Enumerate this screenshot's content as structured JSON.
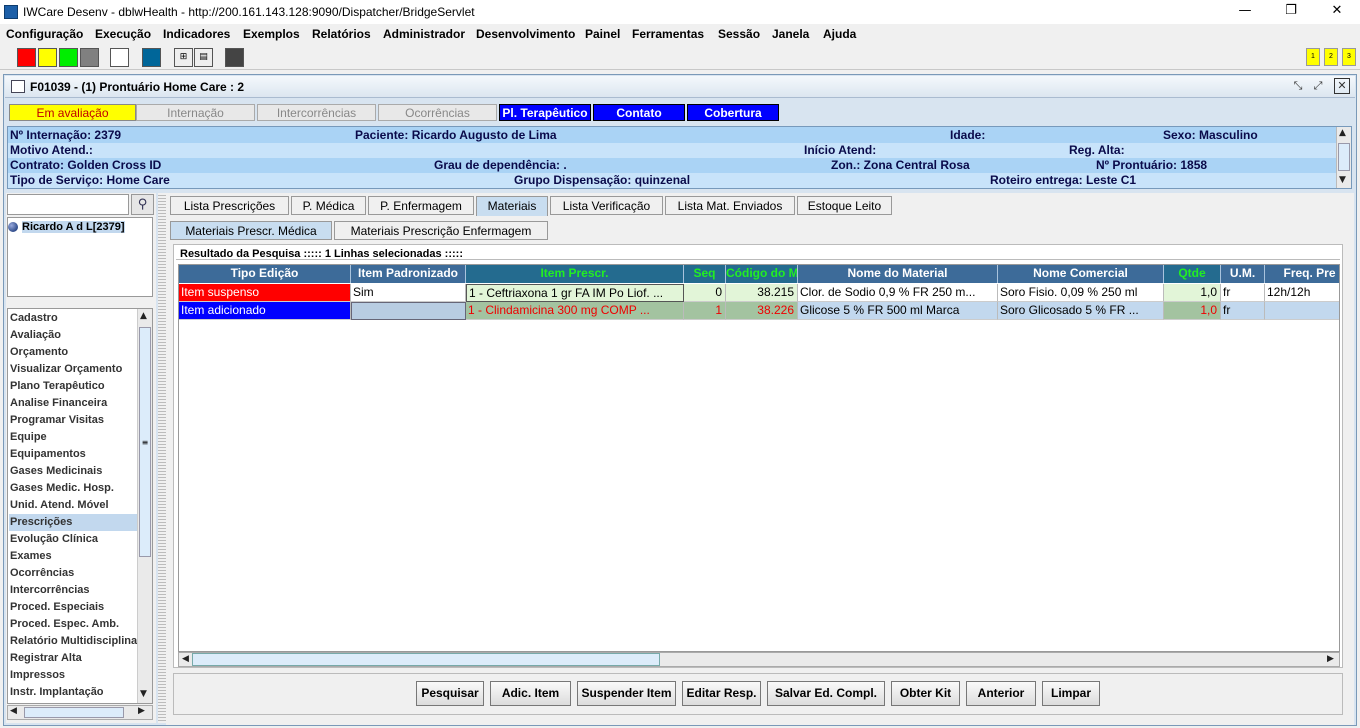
{
  "window": {
    "title": "IWCare Desenv - dblwHealth - http://200.161.143.128:9090/Dispatcher/BridgeServlet",
    "minimize": "—",
    "maximize": "❐",
    "close": "✕"
  },
  "menu": [
    "Configuração",
    "Execução",
    "Indicadores",
    "Exemplos",
    "Relatórios",
    "Administrador",
    "Desenvolvimento",
    "Painel",
    "Ferramentas",
    "Sessão",
    "Janela",
    "Ajuda"
  ],
  "toolbar": {
    "swatch_colors": [
      "#ff0000",
      "#ffff00",
      "#00ee00",
      "#808080",
      "#ffffff",
      "#006699",
      "#444444"
    ],
    "numbered_buttons": [
      "1",
      "2",
      "3"
    ]
  },
  "frame": {
    "title": "F01039 - (1) Prontuário Home Care : 2"
  },
  "status_tabs": [
    {
      "label": "Em avaliação",
      "style": "yellow"
    },
    {
      "label": "Internação",
      "style": "gray"
    },
    {
      "label": "Intercorrências",
      "style": "gray"
    },
    {
      "label": "Ocorrências",
      "style": "gray"
    },
    {
      "label": "Pl. Terapêutico",
      "style": "blue"
    },
    {
      "label": "Contato",
      "style": "blue"
    },
    {
      "label": "Cobertura",
      "style": "blue"
    }
  ],
  "info": {
    "internacao": "Nº Internação: 2379",
    "paciente": "Paciente: Ricardo Augusto de Lima",
    "idade": "Idade:",
    "sexo": "Sexo: Masculino",
    "motivo": "Motivo Atend.:",
    "inicio": "Início Atend:",
    "reg_alta": "Reg. Alta:",
    "contrato": "Contrato: Golden Cross ID",
    "grau": "Grau de dependência: .",
    "zona": "Zon.: Zona Central Rosa",
    "prontuario": "Nº Prontuário: 1858",
    "servico": "Tipo de Serviço: Home Care",
    "grupo": "Grupo Dispensação: quinzenal",
    "roteiro": "Roteiro entrega: Leste C1"
  },
  "patient_list": [
    "Ricardo A d L[2379]"
  ],
  "nav_items": [
    "Cadastro",
    "Avaliação",
    "Orçamento",
    "Visualizar Orçamento",
    "Plano Terapêutico",
    "Analise Financeira",
    "Programar Visitas",
    "Equipe",
    "Equipamentos",
    "Gases Medicinais",
    "Gases Medic. Hosp.",
    "Unid. Atend. Móvel",
    "Prescrições",
    "Evolução Clínica",
    "Exames",
    "Ocorrências",
    "Intercorrências",
    "Proced. Especiais",
    "Proced. Espec. Amb.",
    "Relatório Multidisciplina",
    "Registrar Alta",
    "Impressos",
    "Instr. Implantação"
  ],
  "nav_selected": "Prescrições",
  "tabs": [
    "Lista Prescrições",
    "P. Médica",
    "P. Enfermagem",
    "Materiais",
    "Lista Verificação",
    "Lista Mat. Enviados",
    "Estoque Leito"
  ],
  "active_tab": "Materiais",
  "subtabs": [
    "Materiais Prescr. Médica",
    "Materiais Prescrição Enfermagem"
  ],
  "active_subtab": "Materiais Prescr. Médica",
  "results_title": "Resultado da Pesquisa ::::: 1 Linhas selecionadas :::::",
  "grid": {
    "columns": [
      "Tipo Edição",
      "Item Padronizado",
      "Item Prescr.",
      "Seq",
      "Código do M",
      "Nome do Material",
      "Nome Comercial",
      "Qtde",
      "U.M.",
      "Freq. Pre"
    ],
    "rows": [
      [
        "Item suspenso",
        "Sim",
        "1 - Ceftriaxona    1 gr  FA  IM Po Liof. ...",
        "0",
        "38.215",
        "Clor. de Sodio   0,9 %  FR  250 m...",
        "Soro Fisio.  0,09 %  250 ml",
        "1,0",
        "fr",
        "12h/12h"
      ],
      [
        "Item adicionado",
        "",
        "1 - Clindamicina    300 mg  COMP    ...",
        "1",
        "38.226",
        "Glicose    5 %  FR  500 ml   Marca",
        "Soro Glicosado   5 %  FR  ...",
        "1,0",
        "fr",
        ""
      ]
    ]
  },
  "buttons": [
    "Pesquisar",
    "Adic. Item",
    "Suspender Item",
    "Editar Resp.",
    "Salvar Ed. Compl.",
    "Obter Kit",
    "Anterior",
    "Limpar"
  ],
  "colors": {
    "suspended": "#ff0000",
    "added": "#0000ff",
    "header": "#3d6b99",
    "accent_green": "#22ee22"
  }
}
